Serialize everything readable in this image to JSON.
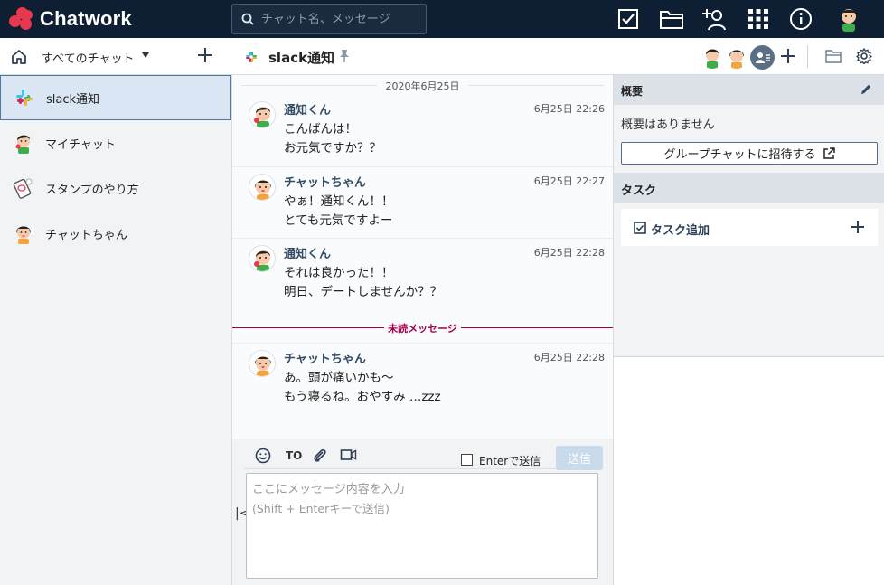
{
  "app": {
    "name": "Chatwork",
    "search_placeholder": "チャット名、メッセージ"
  },
  "sidebar": {
    "filter_label": "すべてのチャット",
    "rooms": [
      {
        "label": "slack通知",
        "icon": "slack-icon",
        "active": true
      },
      {
        "label": "マイチャット",
        "icon": "avatar-boy-icon",
        "active": false
      },
      {
        "label": "スタンプのやり方",
        "icon": "phone-stamp-icon",
        "active": false
      },
      {
        "label": "チャットちゃん",
        "icon": "avatar-girl-icon",
        "active": false
      }
    ]
  },
  "room": {
    "title": "slack通知",
    "date_separator": "2020年6月25日",
    "unread_label": "未読メッセージ",
    "messages": [
      {
        "sender": "通知くん",
        "time": "6月25日 22:26",
        "lines": [
          "こんばんは！",
          "お元気ですか？？"
        ],
        "avatar": "boy"
      },
      {
        "sender": "チャットちゃん",
        "time": "6月25日 22:27",
        "lines": [
          "やぁ！通知くん！！",
          "とても元気ですよー"
        ],
        "avatar": "girl"
      },
      {
        "sender": "通知くん",
        "time": "6月25日 22:28",
        "lines": [
          "それは良かった！！",
          "明日、デートしませんか？？"
        ],
        "avatar": "boy"
      },
      {
        "sender": "チャットちゃん",
        "time": "6月25日 22:28",
        "lines": [
          "あ。頭が痛いかも〜",
          "もう寝るね。おやすみ …zzz"
        ],
        "avatar": "girl"
      }
    ]
  },
  "composer": {
    "to_label": "TO",
    "enter_send_label": "Enterで送信",
    "send_label": "送信",
    "placeholder_line1": "ここにメッセージ内容を入力",
    "placeholder_line2": "(Shift + Enterキーで送信)"
  },
  "right_panel": {
    "overview_title": "概要",
    "overview_text": "概要はありません",
    "invite_label": "グループチャットに招待する",
    "task_title": "タスク",
    "task_add_label": "タスク追加"
  },
  "colors": {
    "topbar": "#0e1f33",
    "brand_red": "#e8384f",
    "unread": "#a5004a",
    "active_room": "#dae6f3"
  }
}
